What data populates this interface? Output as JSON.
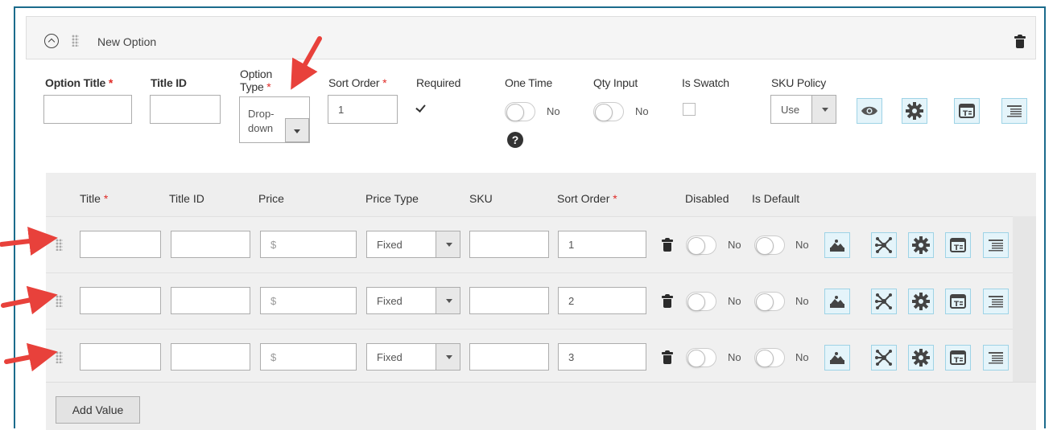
{
  "section": {
    "title": "New Option"
  },
  "option": {
    "title_label": "Option Title",
    "title_id_label": "Title ID",
    "type_label_line1": "Option",
    "type_label_line2": "Type",
    "type_value_line1": "Drop-",
    "type_value_line2": "down",
    "sort_order_label": "Sort Order",
    "sort_order_value": "1",
    "required_label": "Required",
    "required_checked": true,
    "one_time_label": "One Time",
    "one_time_value": "No",
    "qty_input_label": "Qty Input",
    "qty_input_value": "No",
    "is_swatch_label": "Is Swatch",
    "sku_policy_label": "SKU Policy",
    "sku_policy_value": "Use",
    "help_glyph": "?"
  },
  "values_header": {
    "title": "Title",
    "title_id": "Title ID",
    "price": "Price",
    "price_type": "Price Type",
    "sku": "SKU",
    "sort_order": "Sort Order",
    "disabled": "Disabled",
    "is_default": "Is Default"
  },
  "rows": [
    {
      "price_placeholder": "$",
      "price_type": "Fixed",
      "sort_order": "1",
      "disabled": "No",
      "is_default": "No"
    },
    {
      "price_placeholder": "$",
      "price_type": "Fixed",
      "sort_order": "2",
      "disabled": "No",
      "is_default": "No"
    },
    {
      "price_placeholder": "$",
      "price_type": "Fixed",
      "sort_order": "3",
      "disabled": "No",
      "is_default": "No"
    }
  ],
  "add_value_label": "Add Value",
  "required_marker": "*",
  "colors": {
    "required": "#e02b27",
    "frame_border": "#1b6b8c",
    "icon_button_bg": "#e4f4fa",
    "annotation_arrow": "#e8413b"
  },
  "icons": [
    "collapse-icon",
    "drag-grip-icon",
    "trash-icon",
    "eye-icon",
    "gear-icon",
    "text-template-icon",
    "align-lines-icon",
    "image-icon",
    "dependency-icon",
    "help-icon"
  ]
}
